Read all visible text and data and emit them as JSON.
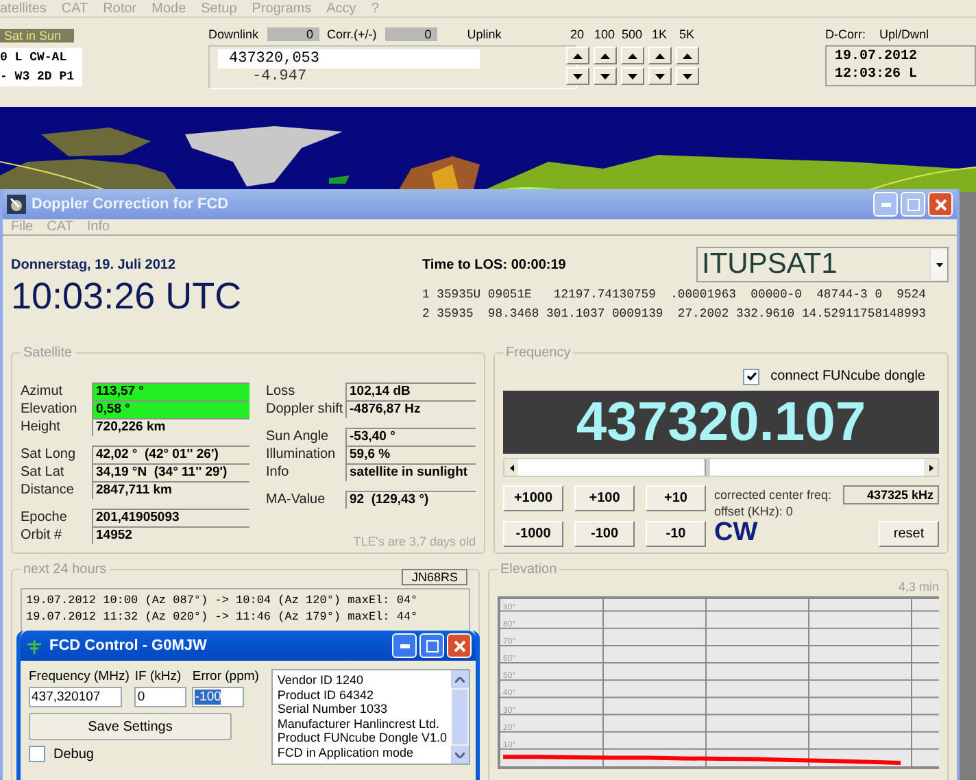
{
  "tracker": {
    "menu": [
      "atellites",
      "CAT",
      "Rotor",
      "Mode",
      "Setup",
      "Programs",
      "Accy",
      "?"
    ],
    "sat_status": "Sat in Sun",
    "mode_lines": [
      "0 L CW-AL",
      "- W3 2D P1"
    ],
    "downlink_label": "Downlink",
    "downlink_corr": "0",
    "corr_label": "Corr.(+/-)",
    "corr_value": "0",
    "uplink_label": "Uplink",
    "frequency": "437320,053",
    "doppler": "-4.947",
    "steps": [
      "20",
      "100",
      "500",
      "1K",
      "5K"
    ],
    "dcorr_label": "D-Corr:",
    "upl_label": "Upl/Dwnl",
    "date": "19.07.2012",
    "time": "12:03:26 L"
  },
  "main_window": {
    "title": "Doppler Correction for FCD",
    "menu": [
      "File",
      "CAT",
      "Info"
    ],
    "date": "Donnerstag, 19. Juli 2012",
    "utc_time": "10:03:26 UTC",
    "los": "Time to LOS: 00:00:19",
    "satellite": "ITUPSAT1",
    "tle": [
      "1 35935U 09051E   12197.74130759  .00001963  00000-0  48744-3 0  9524",
      "2 35935  98.3468 301.1037 0009139  27.2002 332.9610 14.52911758148993"
    ]
  },
  "satellite": {
    "title": "Satellite",
    "left_groups": [
      [
        {
          "label": "Azimut",
          "value": "113,57 °",
          "highlighted": true
        },
        {
          "label": "Elevation",
          "value": "0,58 °",
          "highlighted": true
        },
        {
          "label": "Height",
          "value": "720,226 km",
          "highlighted": false
        }
      ],
      [
        {
          "label": "Sat Long",
          "value": "42,02 °  (42° 01'' 26')",
          "highlighted": false
        },
        {
          "label": "Sat Lat",
          "value": "34,19 °N  (34° 11'' 29')",
          "highlighted": false
        },
        {
          "label": "Distance",
          "value": "2847,711 km",
          "highlighted": false
        }
      ],
      [
        {
          "label": "Epoche",
          "value": "201,41905093",
          "highlighted": false
        },
        {
          "label": "Orbit #",
          "value": "14952",
          "highlighted": false
        }
      ]
    ],
    "right_groups": [
      [
        {
          "label": "Loss",
          "value": "102,14 dB",
          "highlighted": false
        },
        {
          "label": "Doppler shift",
          "value": "-4876,87 Hz",
          "highlighted": false
        }
      ],
      [
        {
          "label": "Sun Angle",
          "value": "-53,40 °",
          "highlighted": false
        },
        {
          "label": "Illumination",
          "value": "59,6 %",
          "highlighted": false
        },
        {
          "label": "Info",
          "value": "satellite in sunlight",
          "highlighted": false
        }
      ],
      [
        {
          "label": "MA-Value",
          "value": "92  (129,43 °)",
          "highlighted": false
        }
      ]
    ],
    "note": "TLE's are 3,7 days old"
  },
  "frequency": {
    "title": "Frequency",
    "connect_dongle": {
      "label": "connect FUNcube dongle",
      "checked": true
    },
    "display": "437320.107",
    "slider": {
      "level": 0.46
    },
    "buttons": [
      "+1000",
      "+100",
      "+10",
      "-1000",
      "-100",
      "-10"
    ],
    "corrected_label": "corrected center freq:",
    "corrected_value": "437325 kHz",
    "offset": "offset (KHz): 0",
    "mode": "CW",
    "reset": "reset"
  },
  "passes": {
    "title": "next 24 hours",
    "locator": "JN68RS",
    "lines": [
      "19.07.2012 10:00 (Az 087°) -> 10:04 (Az 120°) maxEl: 04°",
      "19.07.2012 11:32 (Az 020°) -> 11:46 (Az 179°) maxEl: 44°"
    ]
  },
  "elevation": {
    "title": "Elevation",
    "duration": "4,3 min",
    "chart_data": {
      "type": "line",
      "ylim": [
        0,
        97
      ],
      "grid": true,
      "yticks": [
        {
          "value": 10,
          "label": "10°"
        },
        {
          "value": 20,
          "label": "20°"
        },
        {
          "value": 30,
          "label": "30°"
        },
        {
          "value": 40,
          "label": "40°"
        },
        {
          "value": 50,
          "label": "50°"
        },
        {
          "value": 60,
          "label": "60°"
        },
        {
          "value": 70,
          "label": "70°"
        },
        {
          "value": 80,
          "label": "80°"
        },
        {
          "value": 90,
          "label": "90°"
        }
      ],
      "series": [
        {
          "color": "#ff0000",
          "values": [
            5.5,
            5.5,
            5.2,
            5,
            5,
            4.6,
            4.4,
            4.2,
            3.6,
            3.2,
            2.6,
            2
          ]
        }
      ]
    }
  },
  "fcd_control": {
    "title": "FCD Control - G0MJW",
    "fields": [
      {
        "label": "Frequency (MHz)",
        "value": "437,320107",
        "text_selected": false
      },
      {
        "label": "IF (kHz)",
        "value": "0",
        "text_selected": false
      },
      {
        "label": "Error (ppm)",
        "value": "-100",
        "text_selected": true
      }
    ],
    "save": "Save Settings",
    "debug": {
      "label": "Debug",
      "checked": false
    },
    "info": [
      "Vendor ID 1240",
      "Product ID 64342",
      "Serial Number 1033",
      "Manufacturer Hanlincrest Ltd.",
      "Product FUNcube Dongle V1.0",
      "FCD in Application mode"
    ]
  }
}
